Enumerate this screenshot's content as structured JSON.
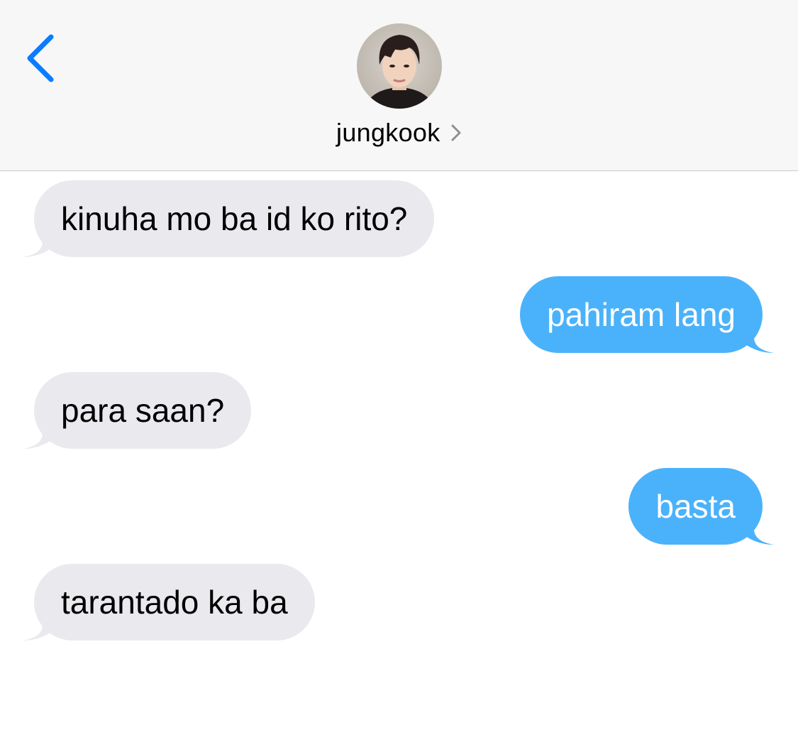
{
  "header": {
    "contact_name": "jungkook"
  },
  "colors": {
    "accent": "#0a7cff",
    "incoming_bubble": "#e9e9ee",
    "outgoing_bubble": "#4ab2fb",
    "header_bg": "#f7f7f7"
  },
  "messages": [
    {
      "direction": "incoming",
      "text": "kinuha mo ba id ko rito?"
    },
    {
      "direction": "outgoing",
      "text": "pahiram lang"
    },
    {
      "direction": "incoming",
      "text": "para saan?"
    },
    {
      "direction": "outgoing",
      "text": "basta"
    },
    {
      "direction": "incoming",
      "text": "tarantado ka ba"
    }
  ]
}
